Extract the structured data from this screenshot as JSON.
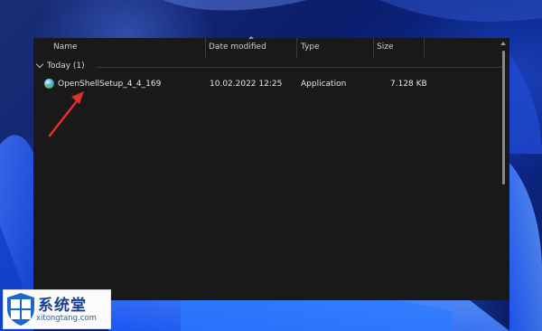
{
  "explorer": {
    "columns": {
      "name": "Name",
      "date_modified": "Date modified",
      "type": "Type",
      "size": "Size"
    },
    "group": {
      "label": "Today (1)"
    },
    "files": [
      {
        "name": "OpenShellSetup_4_4_169",
        "date_modified": "10.02.2022 12:25",
        "type": "Application",
        "size": "7.128 KB",
        "icon": "openshell-setup-icon"
      }
    ]
  },
  "annotation": {
    "color": "#e0302a",
    "icon": "red-arrow-icon"
  },
  "watermark": {
    "text": "系统堂",
    "url": "xitongtang.com",
    "icon": "shield-logo-icon"
  },
  "colors": {
    "window_background": "#191919",
    "text": "#e6e6e6"
  }
}
